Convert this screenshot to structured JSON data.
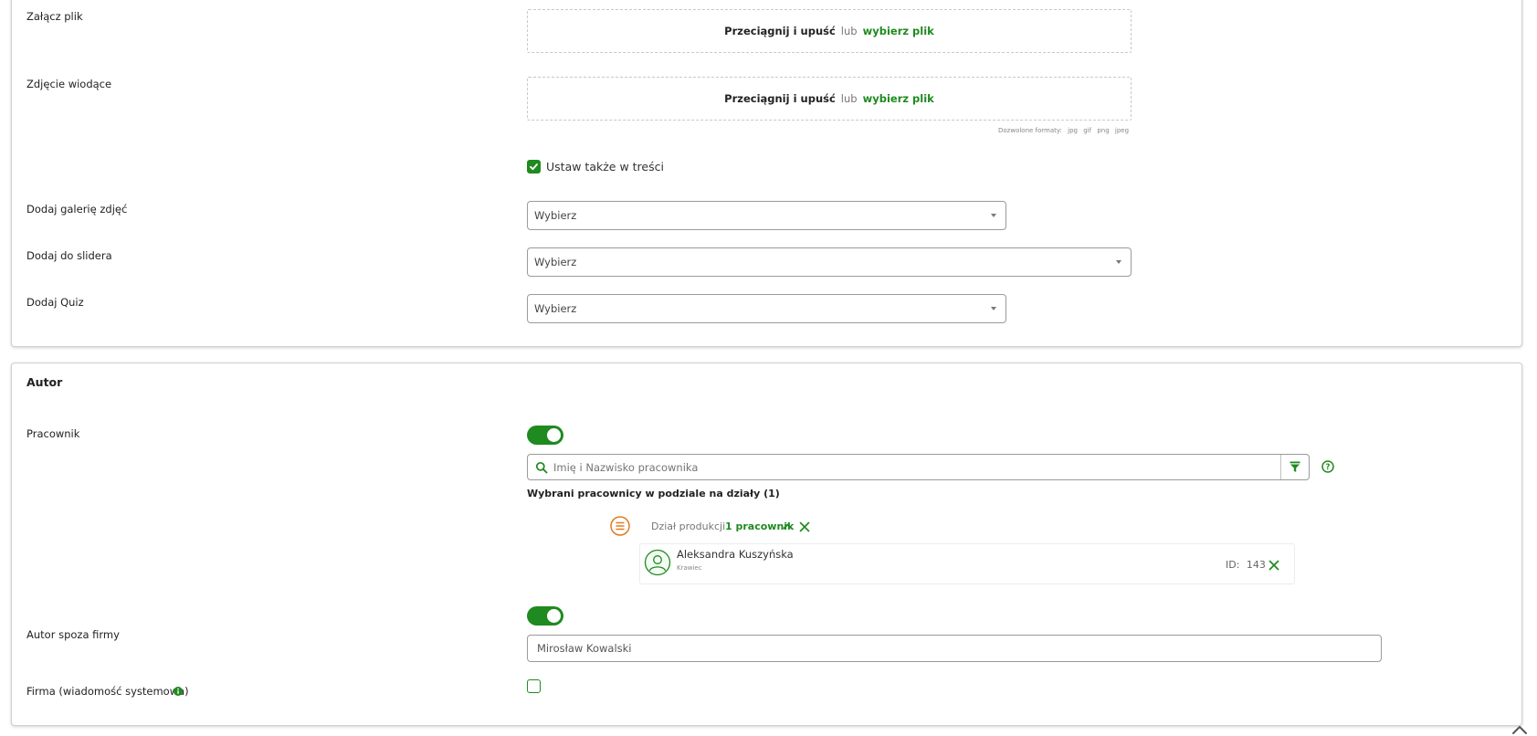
{
  "upload_section": {
    "attach_file": {
      "label": "Załącz plik",
      "dropzone_main": "Przeciągnij i upuść",
      "dropzone_or": "lub",
      "dropzone_link": "wybierz plik"
    },
    "lead_image": {
      "label": "Zdjęcie wiodące",
      "dropzone_main": "Przeciągnij i upuść",
      "dropzone_or": "lub",
      "dropzone_link": "wybierz plik",
      "formats_label": "Dozwolone formaty:",
      "formats": [
        "jpg",
        "gif",
        "png",
        "jpeg"
      ]
    },
    "also_in_content": {
      "label": "Ustaw także w treści",
      "checked": true
    },
    "gallery": {
      "label": "Dodaj galerię zdjęć",
      "value": "Wybierz"
    },
    "slider": {
      "label": "Dodaj do slidera",
      "value": "Wybierz"
    },
    "quiz": {
      "label": "Dodaj Quiz",
      "value": "Wybierz"
    }
  },
  "author_section": {
    "title": "Autor",
    "employee": {
      "label": "Pracownik",
      "toggle_on": true,
      "search_placeholder": "Imię i Nazwisko pracownika",
      "selected_heading": "Wybrani pracownicy w podziale na działy (1)",
      "department": {
        "name": "Dział produkcji",
        "count_label": "1 pracownik",
        "people": [
          {
            "name": "Aleksandra Kuszyńska",
            "role": "Krawiec",
            "id_label": "ID:",
            "id": "143"
          }
        ]
      }
    },
    "external_author": {
      "label": "Autor spoza firmy",
      "toggle_on": true,
      "value": "Mirosław Kowalski"
    },
    "company_message": {
      "label": "Firma (wiadomość systemowa)",
      "checked": false
    }
  },
  "colors": {
    "accent": "#1f8a1f",
    "department_icon": "#e07b1f"
  }
}
